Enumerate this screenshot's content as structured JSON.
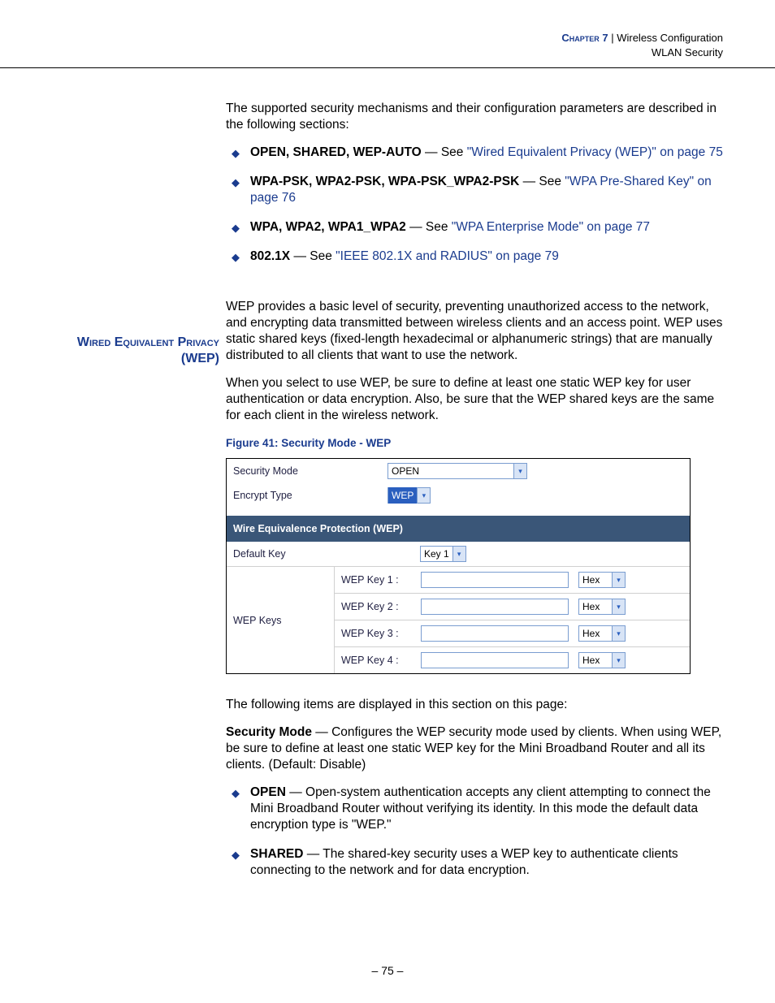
{
  "header": {
    "chapter_label": "Chapter 7",
    "chapter_title": "Wireless Configuration",
    "section_title": "WLAN Security"
  },
  "intro_para": "The supported security mechanisms and their configuration parameters are described in the following sections:",
  "mech_list": [
    {
      "bold": "OPEN, SHARED, WEP-AUTO",
      "dash": " — See ",
      "link": "\"Wired Equivalent Privacy (WEP)\" on page 75"
    },
    {
      "bold": "WPA-PSK, WPA2-PSK, WPA-PSK_WPA2-PSK",
      "dash": " — See ",
      "link": "\"WPA Pre-Shared Key\" on page 76"
    },
    {
      "bold": "WPA, WPA2, WPA1_WPA2",
      "dash": " — See ",
      "link": "\"WPA Enterprise Mode\" on page 77"
    },
    {
      "bold": "802.1X",
      "dash": " — See ",
      "link": "\"IEEE 802.1X and RADIUS\" on page 79"
    }
  ],
  "wep_heading": "Wired Equivalent Privacy (WEP)",
  "wep_para1": "WEP provides a basic level of security, preventing unauthorized access to the network, and encrypting data transmitted between wireless clients and an access point. WEP uses static shared keys (fixed-length hexadecimal or alphanumeric strings) that are manually distributed to all clients that want to use the network.",
  "wep_para2": "When you select to use WEP, be sure to define at least one static WEP key for user authentication or data encryption. Also, be sure that the WEP shared keys are the same for each client in the wireless network.",
  "figure_caption": "Figure 41:  Security Mode - WEP",
  "figure": {
    "security_mode_label": "Security Mode",
    "security_mode_value": "OPEN",
    "encrypt_type_label": "Encrypt Type",
    "encrypt_type_value": "WEP",
    "wep_bar": "Wire Equivalence Protection (WEP)",
    "default_key_label": "Default Key",
    "default_key_value": "Key 1",
    "wep_keys_label": "WEP Keys",
    "keys": [
      {
        "label": "WEP Key 1 :",
        "fmt": "Hex"
      },
      {
        "label": "WEP Key 2 :",
        "fmt": "Hex"
      },
      {
        "label": "WEP Key 3 :",
        "fmt": "Hex"
      },
      {
        "label": "WEP Key 4 :",
        "fmt": "Hex"
      }
    ]
  },
  "after_fig_para": "The following items are displayed in this section on this page:",
  "secmode_bold": "Security Mode",
  "secmode_text": " — Configures the WEP security mode used by clients. When using WEP, be sure to define at least one static WEP key for the Mini Broadband Router and all its clients. (Default: Disable)",
  "mode_list": [
    {
      "bold": "OPEN",
      "text": " — Open-system authentication accepts any client attempting to connect the Mini Broadband Router without verifying its identity. In this mode the default data encryption type is \"WEP.\""
    },
    {
      "bold": "SHARED",
      "text": " — The shared-key security uses a WEP key to authenticate clients connecting to the network and for data encryption."
    }
  ],
  "page_number": "–  75  –"
}
